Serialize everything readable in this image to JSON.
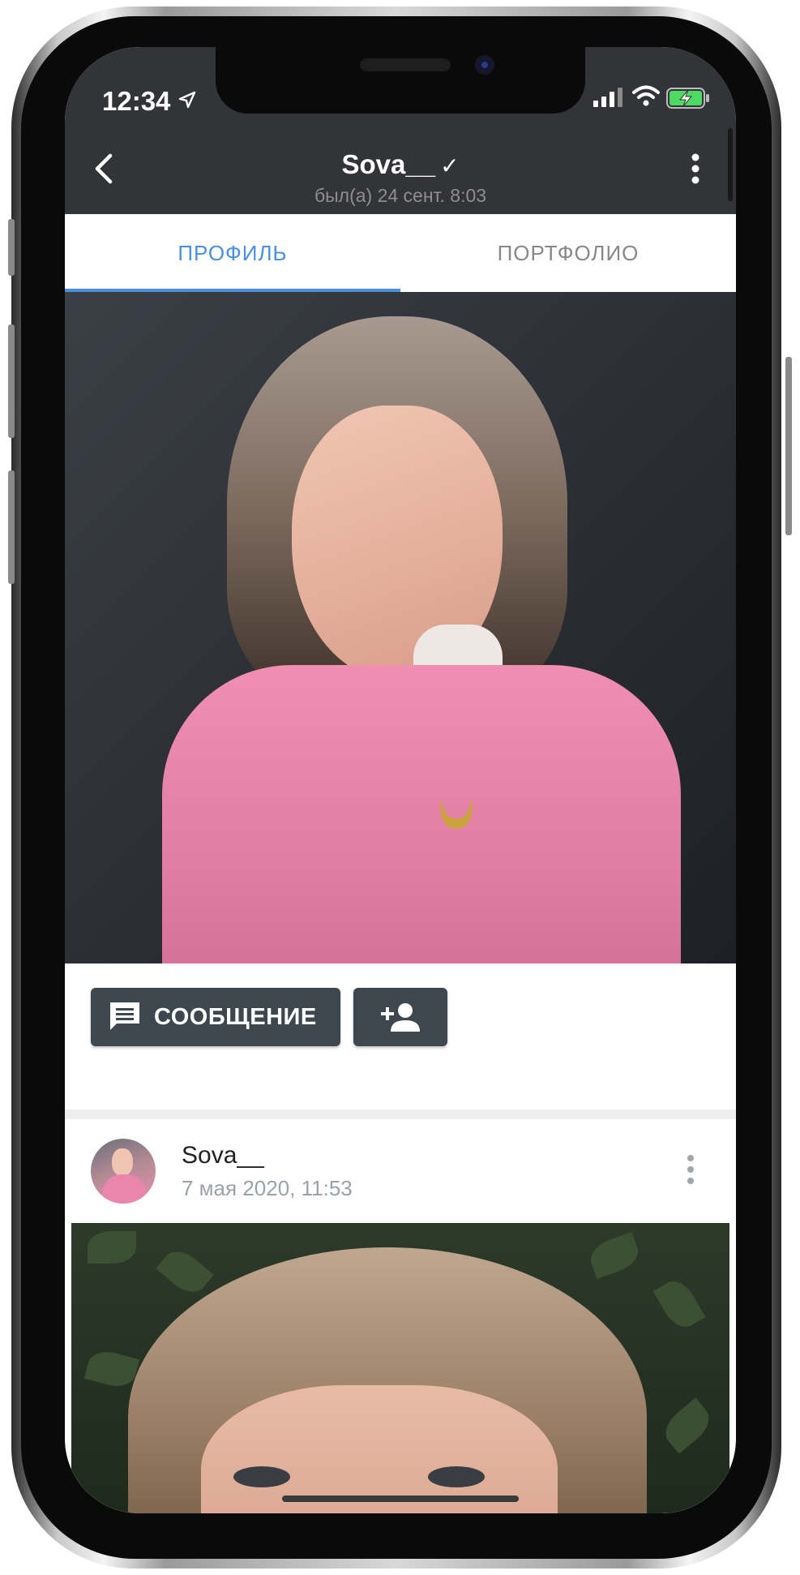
{
  "status_bar": {
    "time": "12:34",
    "icons": [
      "location-arrow-icon",
      "signal-icon",
      "wifi-icon",
      "battery-charging-icon"
    ]
  },
  "header": {
    "title": "Sova__",
    "verified_glyph": "✓",
    "subtitle": "был(а) 24 сент. 8:03",
    "back_icon": "chevron-left-icon",
    "menu_icon": "more-vert-icon"
  },
  "tabs": [
    {
      "label": "ПРОФИЛЬ",
      "active": true
    },
    {
      "label": "ПОРТФОЛИО",
      "active": false
    }
  ],
  "actions": {
    "message_label": "СООБЩЕНИЕ",
    "message_icon": "chat-bubble-icon",
    "add_friend_icon": "person-add-icon"
  },
  "post": {
    "author": "Sova__",
    "date": "7 мая 2020, 11:53",
    "menu_icon": "more-vert-icon"
  },
  "colors": {
    "appbar": "#333438",
    "accent": "#4a90e2",
    "button": "#3e474e",
    "muted_text": "#9aa2a8"
  }
}
